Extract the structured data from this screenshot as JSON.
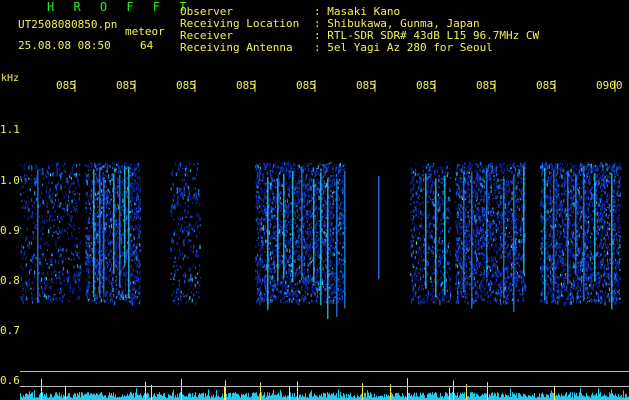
{
  "app": {
    "title": "H R O F F T",
    "filename": "UT2508080850.pn",
    "mode": "meteor",
    "timestamp": "25.08.08 08:50",
    "count": "64"
  },
  "header": [
    {
      "label": "Observer",
      "value": ": Masaki Kano"
    },
    {
      "label": "Receiving Location",
      "value": ": Shibukawa, Gunma, Japan"
    },
    {
      "label": "Receiver",
      "value": ": RTL-SDR SDR# 43dB L15 96.7MHz CW"
    },
    {
      "label": "Receiving Antenna",
      "value": ": 5el Yagi Az 280 for Seoul"
    }
  ],
  "axis": {
    "unit": "kHz",
    "y_labels": [
      "1.1",
      "1.0",
      "0.9",
      "0.8",
      "0.7",
      "0.6"
    ],
    "x_ticks": [
      "085",
      "085",
      "085",
      "085",
      "085",
      "085",
      "085",
      "085",
      "085",
      "0900"
    ]
  },
  "colors": {
    "text": "#f2f25a",
    "title": "#22ee22",
    "activity_bars": "#22ccee",
    "activity_peaks": "#ffee33"
  }
}
